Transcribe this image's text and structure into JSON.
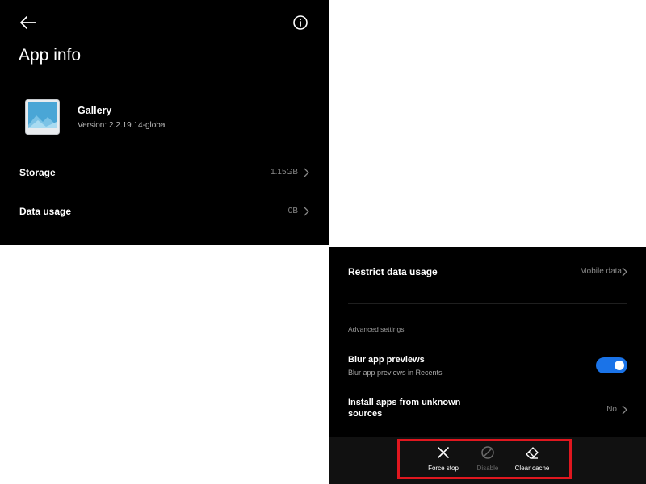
{
  "header": {
    "title": "App info",
    "back_icon": "arrow-left-icon",
    "info_icon": "info-circle-icon"
  },
  "app": {
    "name": "Gallery",
    "version": "Version: 2.2.19.14-global",
    "icon": "gallery-icon"
  },
  "rows": {
    "storage": {
      "label": "Storage",
      "value": "1.15GB"
    },
    "data_usage": {
      "label": "Data usage",
      "value": "0B"
    },
    "restrict_data": {
      "label": "Restrict data usage",
      "value": "Mobile data"
    }
  },
  "advanced": {
    "section_title": "Advanced settings",
    "blur": {
      "label": "Blur app previews",
      "sublabel": "Blur app previews in Recents",
      "enabled": true
    },
    "unknown_sources": {
      "label_line1": "Install apps from unknown",
      "label_line2": "sources",
      "value": "No"
    }
  },
  "actions": {
    "force_stop": {
      "label": "Force stop",
      "icon": "close-icon",
      "enabled": true
    },
    "disable": {
      "label": "Disable",
      "icon": "block-icon",
      "enabled": false
    },
    "clear_cache": {
      "label": "Clear cache",
      "icon": "eraser-icon",
      "enabled": true
    }
  },
  "colors": {
    "background": "#000000",
    "toggle_on": "#1a73e8",
    "highlight": "#e0171f",
    "disabled_text": "#6b6b6b"
  }
}
